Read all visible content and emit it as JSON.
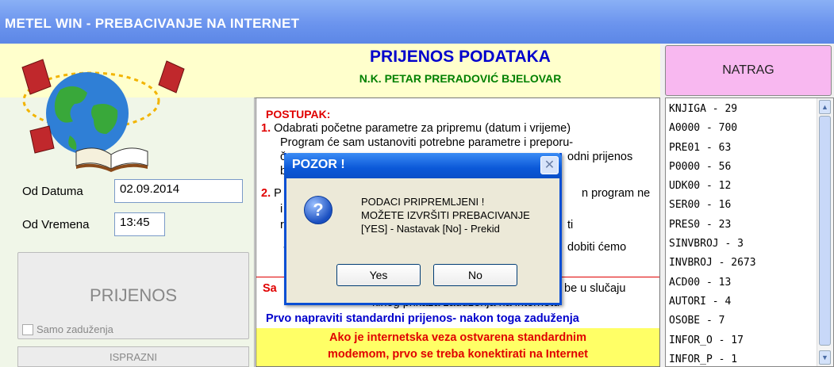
{
  "window": {
    "title": "METEL WIN - PREBACIVANJE NA INTERNET"
  },
  "header": {
    "title": "PRIJENOS PODATAKA",
    "subtitle": "N.K. PETAR PRERADOVIĆ BJELOVAR",
    "back_label": "NATRAG"
  },
  "form": {
    "od_datuma_label": "Od Datuma",
    "od_datuma_value": "02.09.2014",
    "od_vremena_label": "Od Vremena",
    "od_vremena_value": "13:45",
    "prijenos_label": "PRIJENOS",
    "samo_zaduzenja_label": "Samo zaduženja",
    "isprazni_label": "ISPRAZNI"
  },
  "instructions": {
    "title": "POSTUPAK:",
    "n1": "1.",
    "line1": "Odabrati početne parametre za pripremu (datum i vrijeme)",
    "line2": "Program će sam ustanoviti potrebne parametre i preporu-",
    "line3a": "č",
    "line3b": "odni prijenos",
    "line4": "b",
    "n2": "2.",
    "line5a": "P",
    "line5b": "n program ne",
    "line6": "i",
    "line7a": "r",
    "line7b": "ti",
    "line8a": "-",
    "line8b": "dobiti ćemo",
    "red_a": "Sa",
    "red_b": "be u slučaju",
    "red_c": "kinog prikaza zaduženja na internetu",
    "blue_line": "Prvo napraviti standardni prijenos- nakon toga zaduženja",
    "yellow_line1": "Ako je internetska veza ostvarena standardnim",
    "yellow_line2": "modemom, prvo se treba konektirati na Internet"
  },
  "list": {
    "items": [
      "KNJIGA - 29",
      "A0000 - 700",
      "PRE01 - 63",
      "P0000 - 56",
      "UDK00 - 12",
      "SER00 - 16",
      "PRES0 - 23",
      "SINVBROJ - 3",
      "INVBROJ - 2673",
      "ACD00 - 13",
      "AUTORI - 4",
      "OSOBE - 7",
      "INFOR_O - 17",
      "INFOR_P - 1"
    ]
  },
  "dialog": {
    "title": "POZOR !",
    "line1": "PODACI PRIPREMLJENI !",
    "line2": "MOŽETE IZVRŠITI PREBACIVANJE",
    "line3": "[YES] - Nastavak  [No] - Prekid",
    "yes_label": "Yes",
    "no_label": "No",
    "close_symbol": "✕",
    "icon_symbol": "?"
  },
  "icons": {
    "dialog_icon": "question-icon",
    "logo": "globe-books-logo"
  }
}
